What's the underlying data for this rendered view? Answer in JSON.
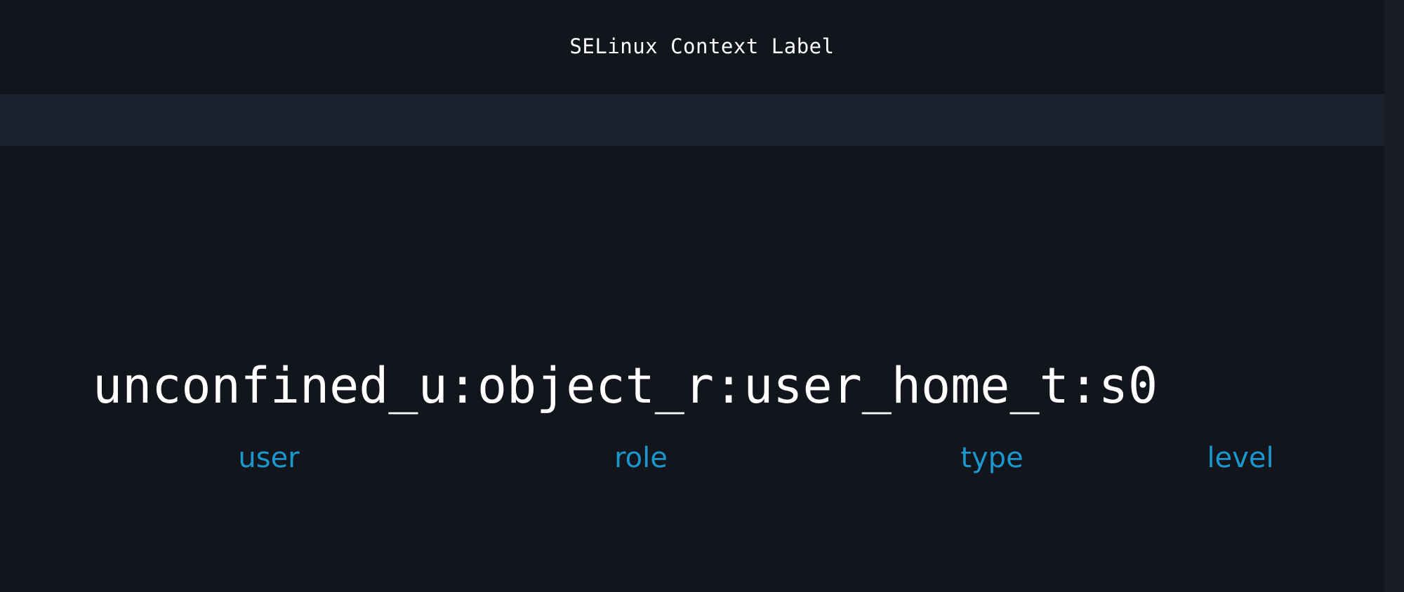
{
  "title": "SELinux Context Label",
  "context": "unconfined_u:object_r:user_home_t:s0",
  "fields": {
    "user": "user",
    "role": "role",
    "type": "type",
    "level": "level"
  },
  "colors": {
    "background": "#12161c",
    "band": "#1b212c",
    "text": "#ffffff",
    "accent": "#1a97cc"
  }
}
